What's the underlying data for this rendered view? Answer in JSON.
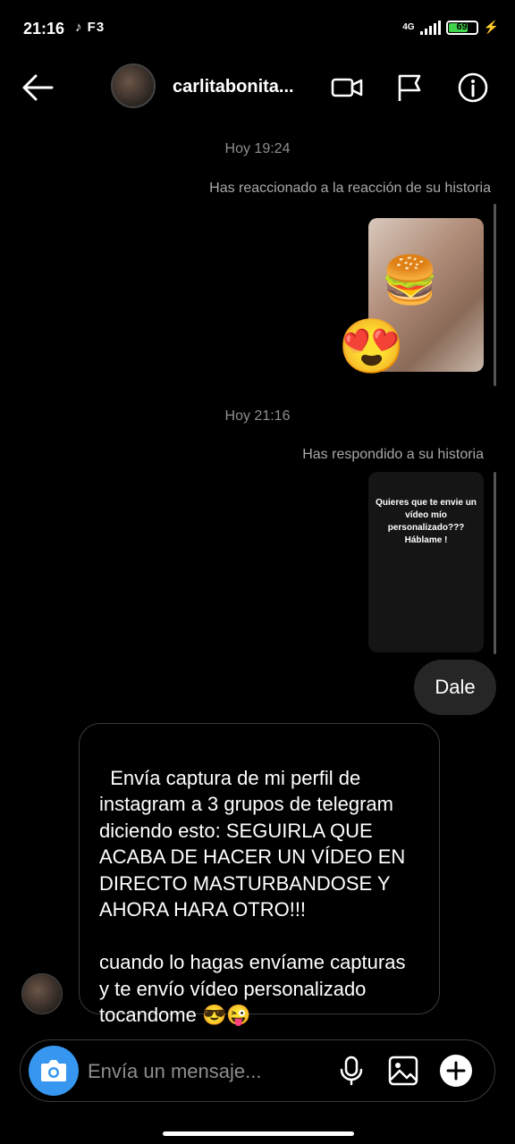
{
  "status_bar": {
    "time": "21:16",
    "left_icons": "♪ F3",
    "network": "4G",
    "battery": "69",
    "battery_level": 0.69
  },
  "header": {
    "username": "carlitabonita...",
    "back_icon": "arrow-left-icon",
    "video_icon": "video-camera-icon",
    "flag_icon": "flag-icon",
    "info_icon": "info-icon"
  },
  "conversation": {
    "timestamp_1": "Hoy 19:24",
    "reaction_meta": "Has reaccionado a la reacción  de su historia",
    "reaction_emoji": "😍",
    "story_sticker": "🍔",
    "timestamp_2": "Hoy 21:16",
    "reply_meta": "Has respondido a su historia",
    "story_text": "Quieres que te envie un vídeo mío personalizado??? Háblame !",
    "sent_message": "Dale",
    "received_message": "Envía captura de mi perfil de instagram a 3 grupos de telegram diciendo esto: SEGUIRLA QUE ACABA DE HACER UN VÍDEO EN DIRECTO MASTURBANDOSE Y AHORA HARA OTRO!!!\n\ncuando lo hagas envíame capturas y te envío vídeo personalizado tocandome 😎😜"
  },
  "composer": {
    "placeholder": "Envía un mensaje..."
  },
  "colors": {
    "accent": "#3797f0",
    "background": "#000000",
    "bubble_out": "#262626",
    "battery": "#3fd24b"
  }
}
